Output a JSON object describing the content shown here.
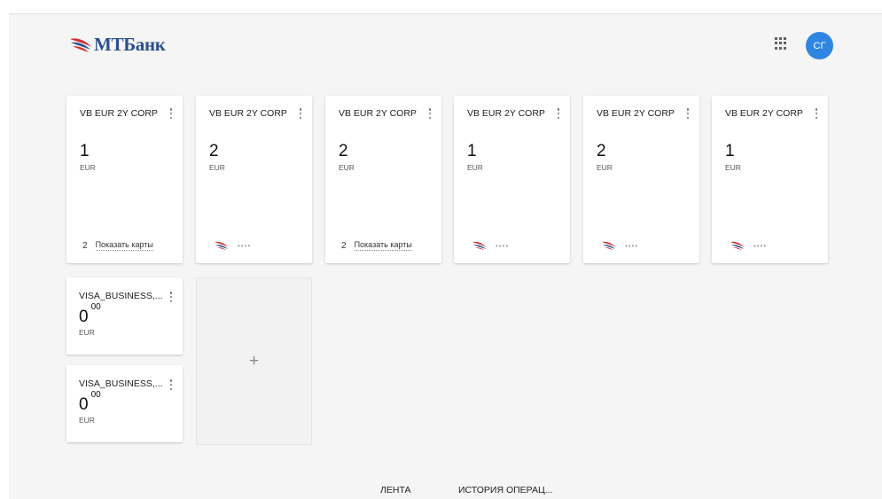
{
  "header": {
    "logo_text": "МТБанк",
    "apps_icon": "apps-grid-icon",
    "avatar_initials": "СГ"
  },
  "accounts": [
    {
      "title": "VB EUR 2Y CORP",
      "amount": "1",
      "currency": "EUR",
      "footer": "count",
      "card_count": "2",
      "show_cards_label": "Показать карты"
    },
    {
      "title": "VB EUR 2Y CORP",
      "amount": "2",
      "currency": "EUR",
      "footer": "masked",
      "masked_number": "••••"
    },
    {
      "title": "VB EUR 2Y CORP",
      "amount": "2",
      "currency": "EUR",
      "footer": "count",
      "card_count": "2",
      "show_cards_label": "Показать карты"
    },
    {
      "title": "VB EUR 2Y CORP",
      "amount": "1",
      "currency": "EUR",
      "footer": "masked",
      "masked_number": "••••"
    },
    {
      "title": "VB EUR 2Y CORP",
      "amount": "2",
      "currency": "EUR",
      "footer": "masked",
      "masked_number": "••••"
    },
    {
      "title": "VB EUR 2Y CORP",
      "amount": "1",
      "currency": "EUR",
      "footer": "masked",
      "masked_number": "••••"
    }
  ],
  "visa_cards": [
    {
      "title": "VISA_BUSINESS,...",
      "amount_int": "0",
      "amount_frac": "00",
      "currency": "EUR"
    },
    {
      "title": "VISA_BUSINESS,...",
      "amount_int": "0",
      "amount_frac": "00",
      "currency": "EUR"
    }
  ],
  "add_tile": {
    "icon": "plus-icon",
    "symbol": "+"
  },
  "tabs": [
    {
      "label": "ЛЕНТА"
    },
    {
      "label": "ИСТОРИЯ ОПЕРАЦ..."
    }
  ],
  "colors": {
    "brand_blue": "#2d4f8e",
    "brand_red": "#d32f2f",
    "avatar": "#2f86e0"
  }
}
